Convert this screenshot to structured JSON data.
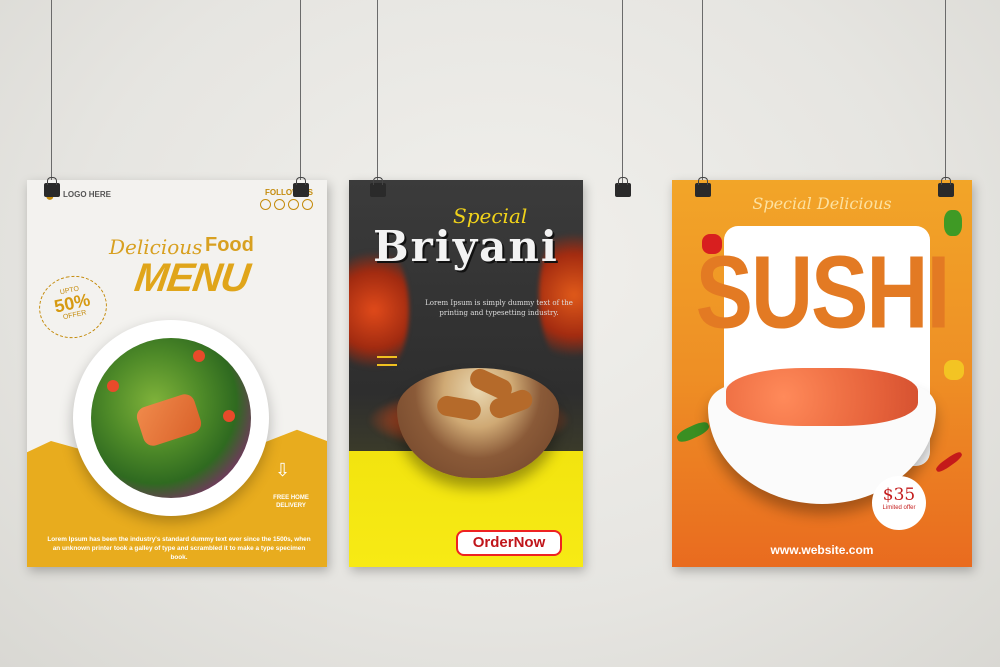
{
  "poster_menu": {
    "logo": "LOGO HERE",
    "follow": "FOLLOW US",
    "title_script": "Delicious",
    "title_food": "Food",
    "title_menu": "MENU",
    "badge_upto": "UPTO",
    "badge_value": "50%",
    "badge_offer": "OFFER",
    "delivery": "FREE HOME DELIVERY",
    "description": "Lorem Ipsum has been the industry's standard dummy text ever since the 1500s, when an unknown printer took a galley of type and scrambled it to make a type specimen book."
  },
  "poster_briyani": {
    "special": "Special",
    "title": "Briyani",
    "description": "Lorem Ipsum is simply dummy text of the printing and typesetting industry.",
    "button": "OrderNow"
  },
  "poster_sushi": {
    "special": "Special Delicious",
    "title": "SUSHI",
    "price": "$35",
    "price_note": "Limited offer",
    "website": "www.website.com"
  },
  "colors": {
    "menu_accent": "#e8ac1e",
    "briyani_yellow": "#f2e40f",
    "sushi_orange": "#ee8f25",
    "order_red": "#c0151a"
  }
}
